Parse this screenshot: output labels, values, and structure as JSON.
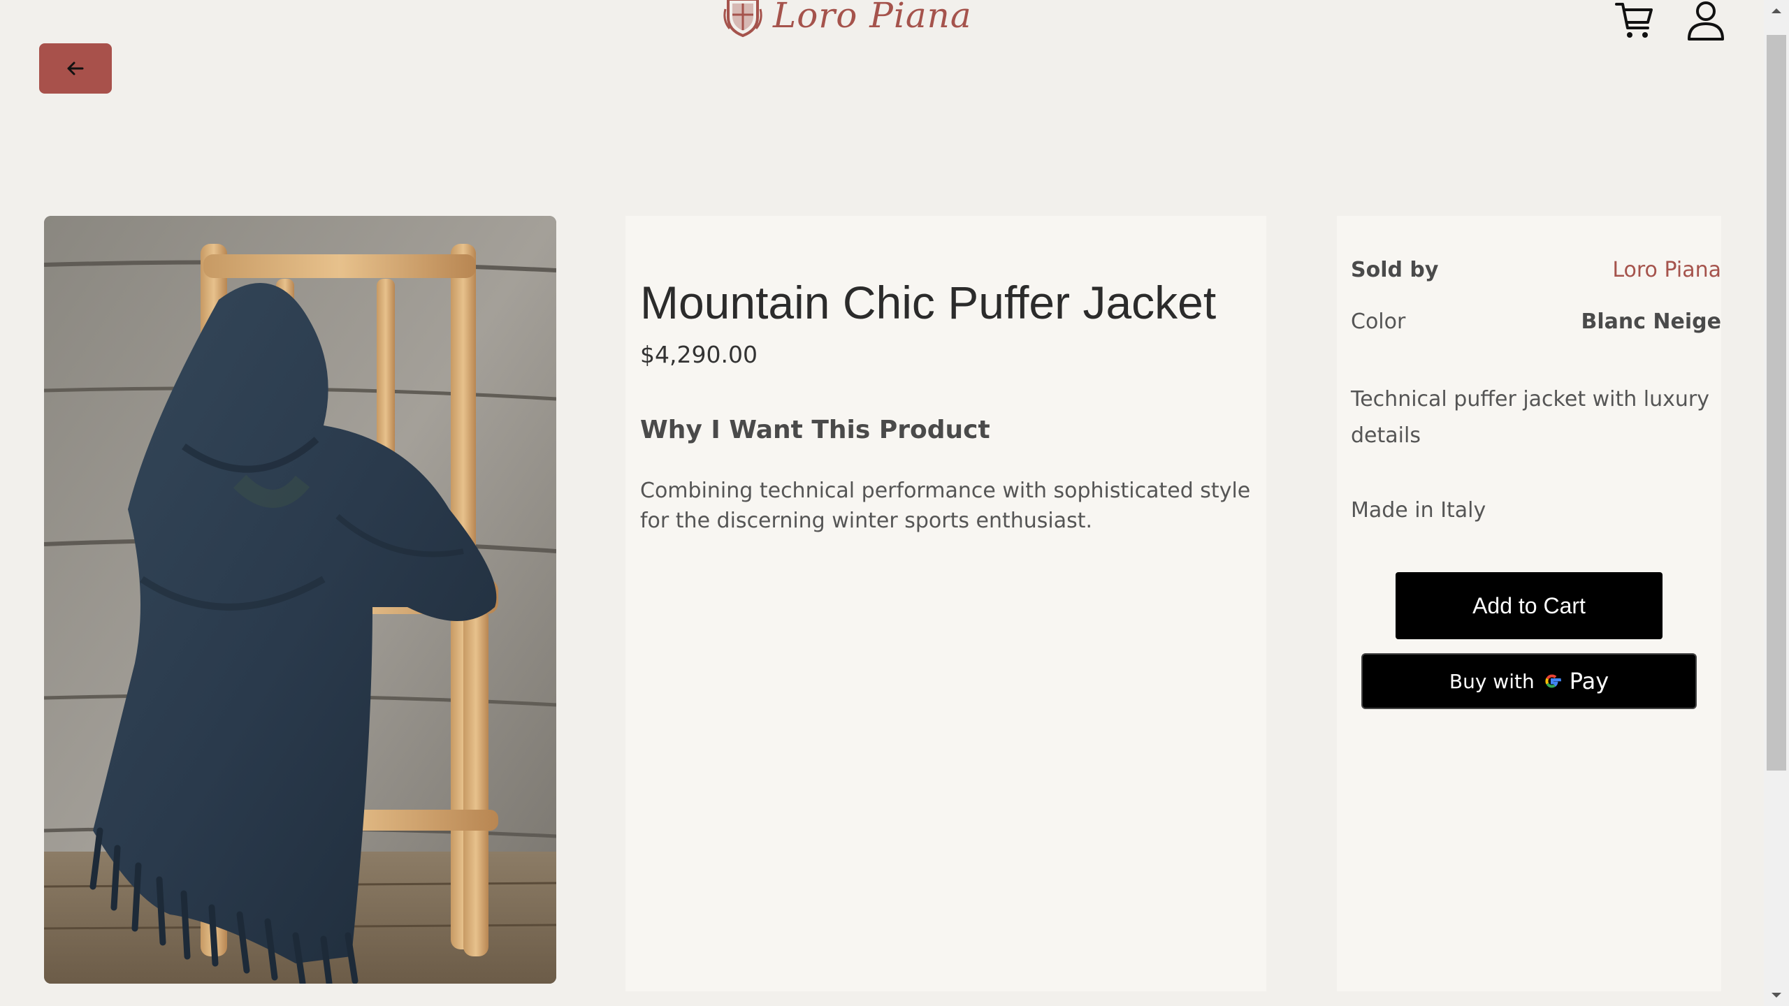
{
  "header": {
    "brand": "Loro Piana",
    "cart_icon": "cart-icon",
    "user_icon": "user-icon",
    "back_icon": "arrow-left-icon"
  },
  "product": {
    "title": "Mountain Chic Puffer Jacket",
    "price": "$4,290.00",
    "why_heading": "Why I Want This Product",
    "why_text": "Combining technical performance with sophisticated style for the discerning winter sports enthusiast."
  },
  "details": {
    "sold_by_label": "Sold by",
    "sold_by_value": "Loro Piana",
    "color_label": "Color",
    "color_value": "Blanc Neige",
    "description": "Technical puffer jacket with luxury details",
    "origin": "Made in Italy",
    "add_to_cart": "Add to Cart",
    "buy_with": "Buy with",
    "pay": "Pay"
  },
  "colors": {
    "accent": "#a8514b",
    "background": "#f2f0ec",
    "panel": "#f8f6f2"
  }
}
